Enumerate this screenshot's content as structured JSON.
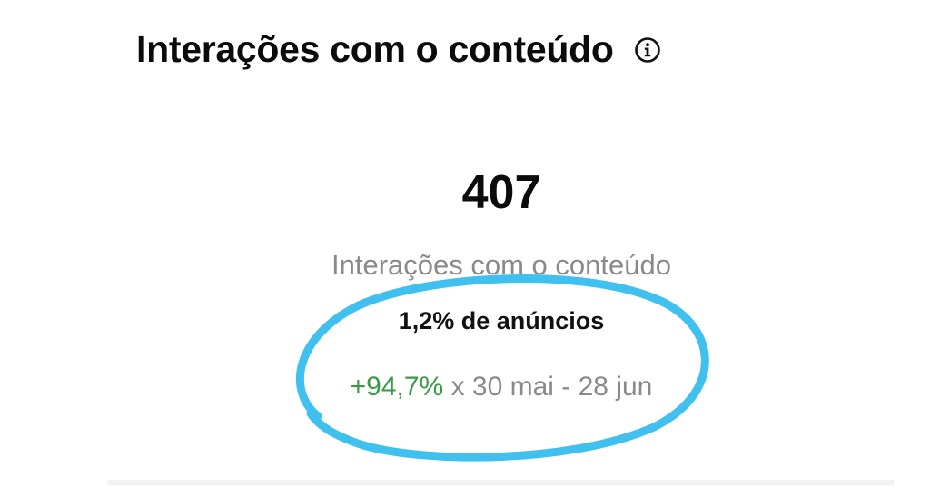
{
  "header": {
    "title": "Interações com o conteúdo",
    "info_icon": "info-circle-icon"
  },
  "metric": {
    "value": "407",
    "label": "Interações com o conteúdo",
    "ad_share": "1,2% de anúncios",
    "change": {
      "percent": "+94,7%",
      "comparison": " x 30 mai - 28 jun"
    }
  },
  "colors": {
    "positive": "#3a9a48",
    "secondary_text": "#8a8a8a",
    "highlight_stroke": "#3fc0ee"
  }
}
